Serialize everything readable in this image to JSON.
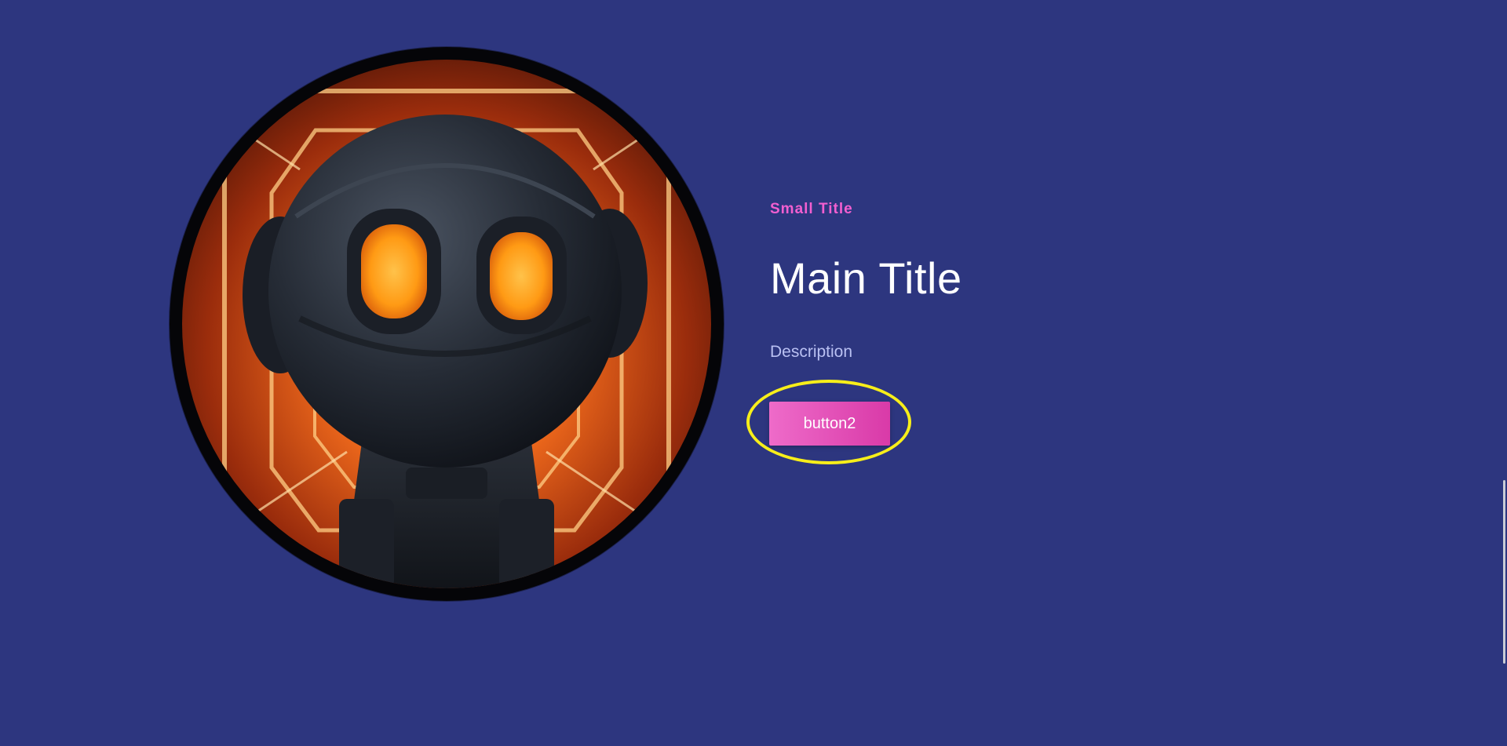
{
  "hero": {
    "small_title": "Small Title",
    "main_title": "Main Title",
    "description": "Description",
    "button_label": "button2"
  },
  "portrait": {
    "icon": "robot-image"
  },
  "colors": {
    "background": "#2d367f",
    "small_title": "#f25fd0",
    "main_title": "#ffffff",
    "description": "#b9c0f2",
    "button_start": "#ee6bc9",
    "button_end": "#d93aa8",
    "highlight_ring": "#f7ee1a"
  }
}
